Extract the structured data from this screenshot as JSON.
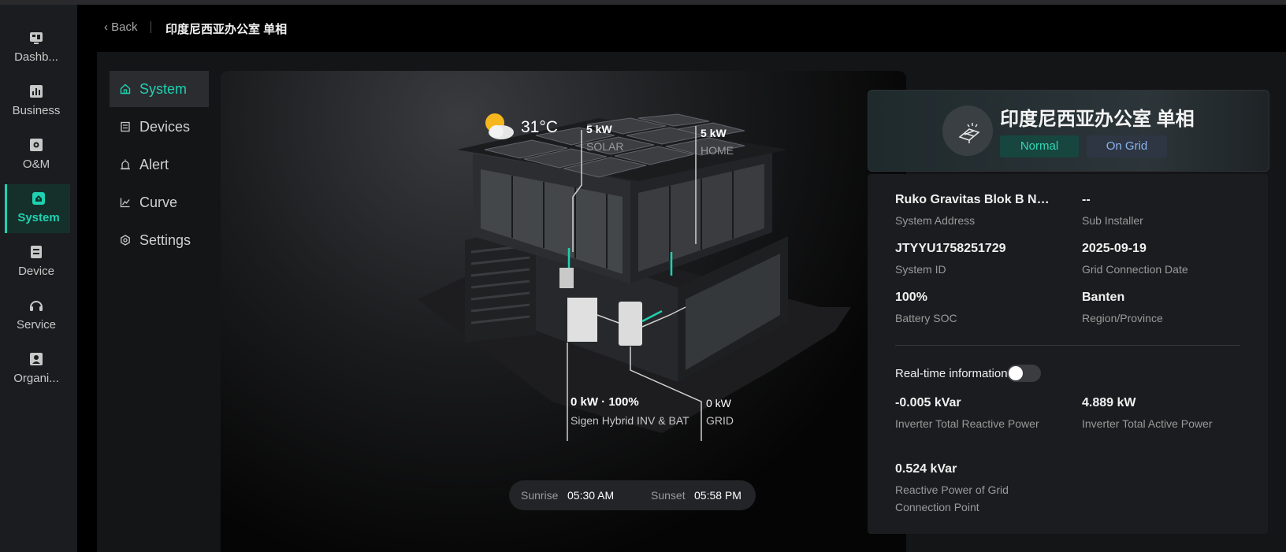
{
  "nav": {
    "items": [
      {
        "label": "Dashb...",
        "icon": "dashboard-icon",
        "active": false
      },
      {
        "label": "Business",
        "icon": "bar-chart-icon",
        "active": false
      },
      {
        "label": "O&M",
        "icon": "maintenance-icon",
        "active": false
      },
      {
        "label": "System",
        "icon": "system-house-icon",
        "active": true
      },
      {
        "label": "Device",
        "icon": "device-icon",
        "active": false
      },
      {
        "label": "Service",
        "icon": "headset-icon",
        "active": false
      },
      {
        "label": "Organi...",
        "icon": "organization-icon",
        "active": false
      }
    ]
  },
  "header": {
    "back_label": "Back",
    "title": "印度尼西亚办公室 单相"
  },
  "subnav": {
    "items": [
      {
        "label": "System",
        "icon": "home-icon",
        "active": true
      },
      {
        "label": "Devices",
        "icon": "devices-icon",
        "active": false
      },
      {
        "label": "Alert",
        "icon": "alarm-icon",
        "active": false
      },
      {
        "label": "Curve",
        "icon": "line-chart-icon",
        "active": false
      },
      {
        "label": "Settings",
        "icon": "settings-icon",
        "active": false
      }
    ]
  },
  "scene": {
    "weather": {
      "icon": "partly-cloudy-icon",
      "temperature": "31°C"
    },
    "solar": {
      "value": "5 kW",
      "label": "SOLAR"
    },
    "home": {
      "value": "5 kW",
      "label": "HOME"
    },
    "inverter": {
      "value": "0 kW · 100%",
      "label": "Sigen Hybrid INV & BAT"
    },
    "grid": {
      "value": "0 kW",
      "label": "GRID"
    },
    "sunrise": {
      "label": "Sunrise",
      "time": "05:30 AM"
    },
    "sunset": {
      "label": "Sunset",
      "time": "05:58 PM"
    }
  },
  "site": {
    "name": "印度尼西亚办公室 单相",
    "status": "Normal",
    "grid_status": "On Grid",
    "colors": {
      "normal": "#34d6b4",
      "on_grid": "#8db4f0",
      "accent": "#1fd1b0"
    }
  },
  "details": [
    {
      "value": "Ruko Gravitas Blok B No...",
      "label": "System Address"
    },
    {
      "value": "--",
      "label": "Sub Installer"
    },
    {
      "value": "JTYYU1758251729",
      "label": "System ID"
    },
    {
      "value": "2025-09-19",
      "label": "Grid Connection Date"
    },
    {
      "value": "100%",
      "label": "Battery SOC"
    },
    {
      "value": "Banten",
      "label": "Region/Province"
    }
  ],
  "realtime": {
    "label": "Real-time information",
    "enabled": false,
    "items": [
      {
        "value": "-0.005 kVar",
        "label": "Inverter Total Reactive Power"
      },
      {
        "value": "4.889 kW",
        "label": "Inverter Total Active Power"
      },
      {
        "value": "0.524 kVar",
        "label": "Reactive Power of Grid Connection Point"
      }
    ]
  }
}
